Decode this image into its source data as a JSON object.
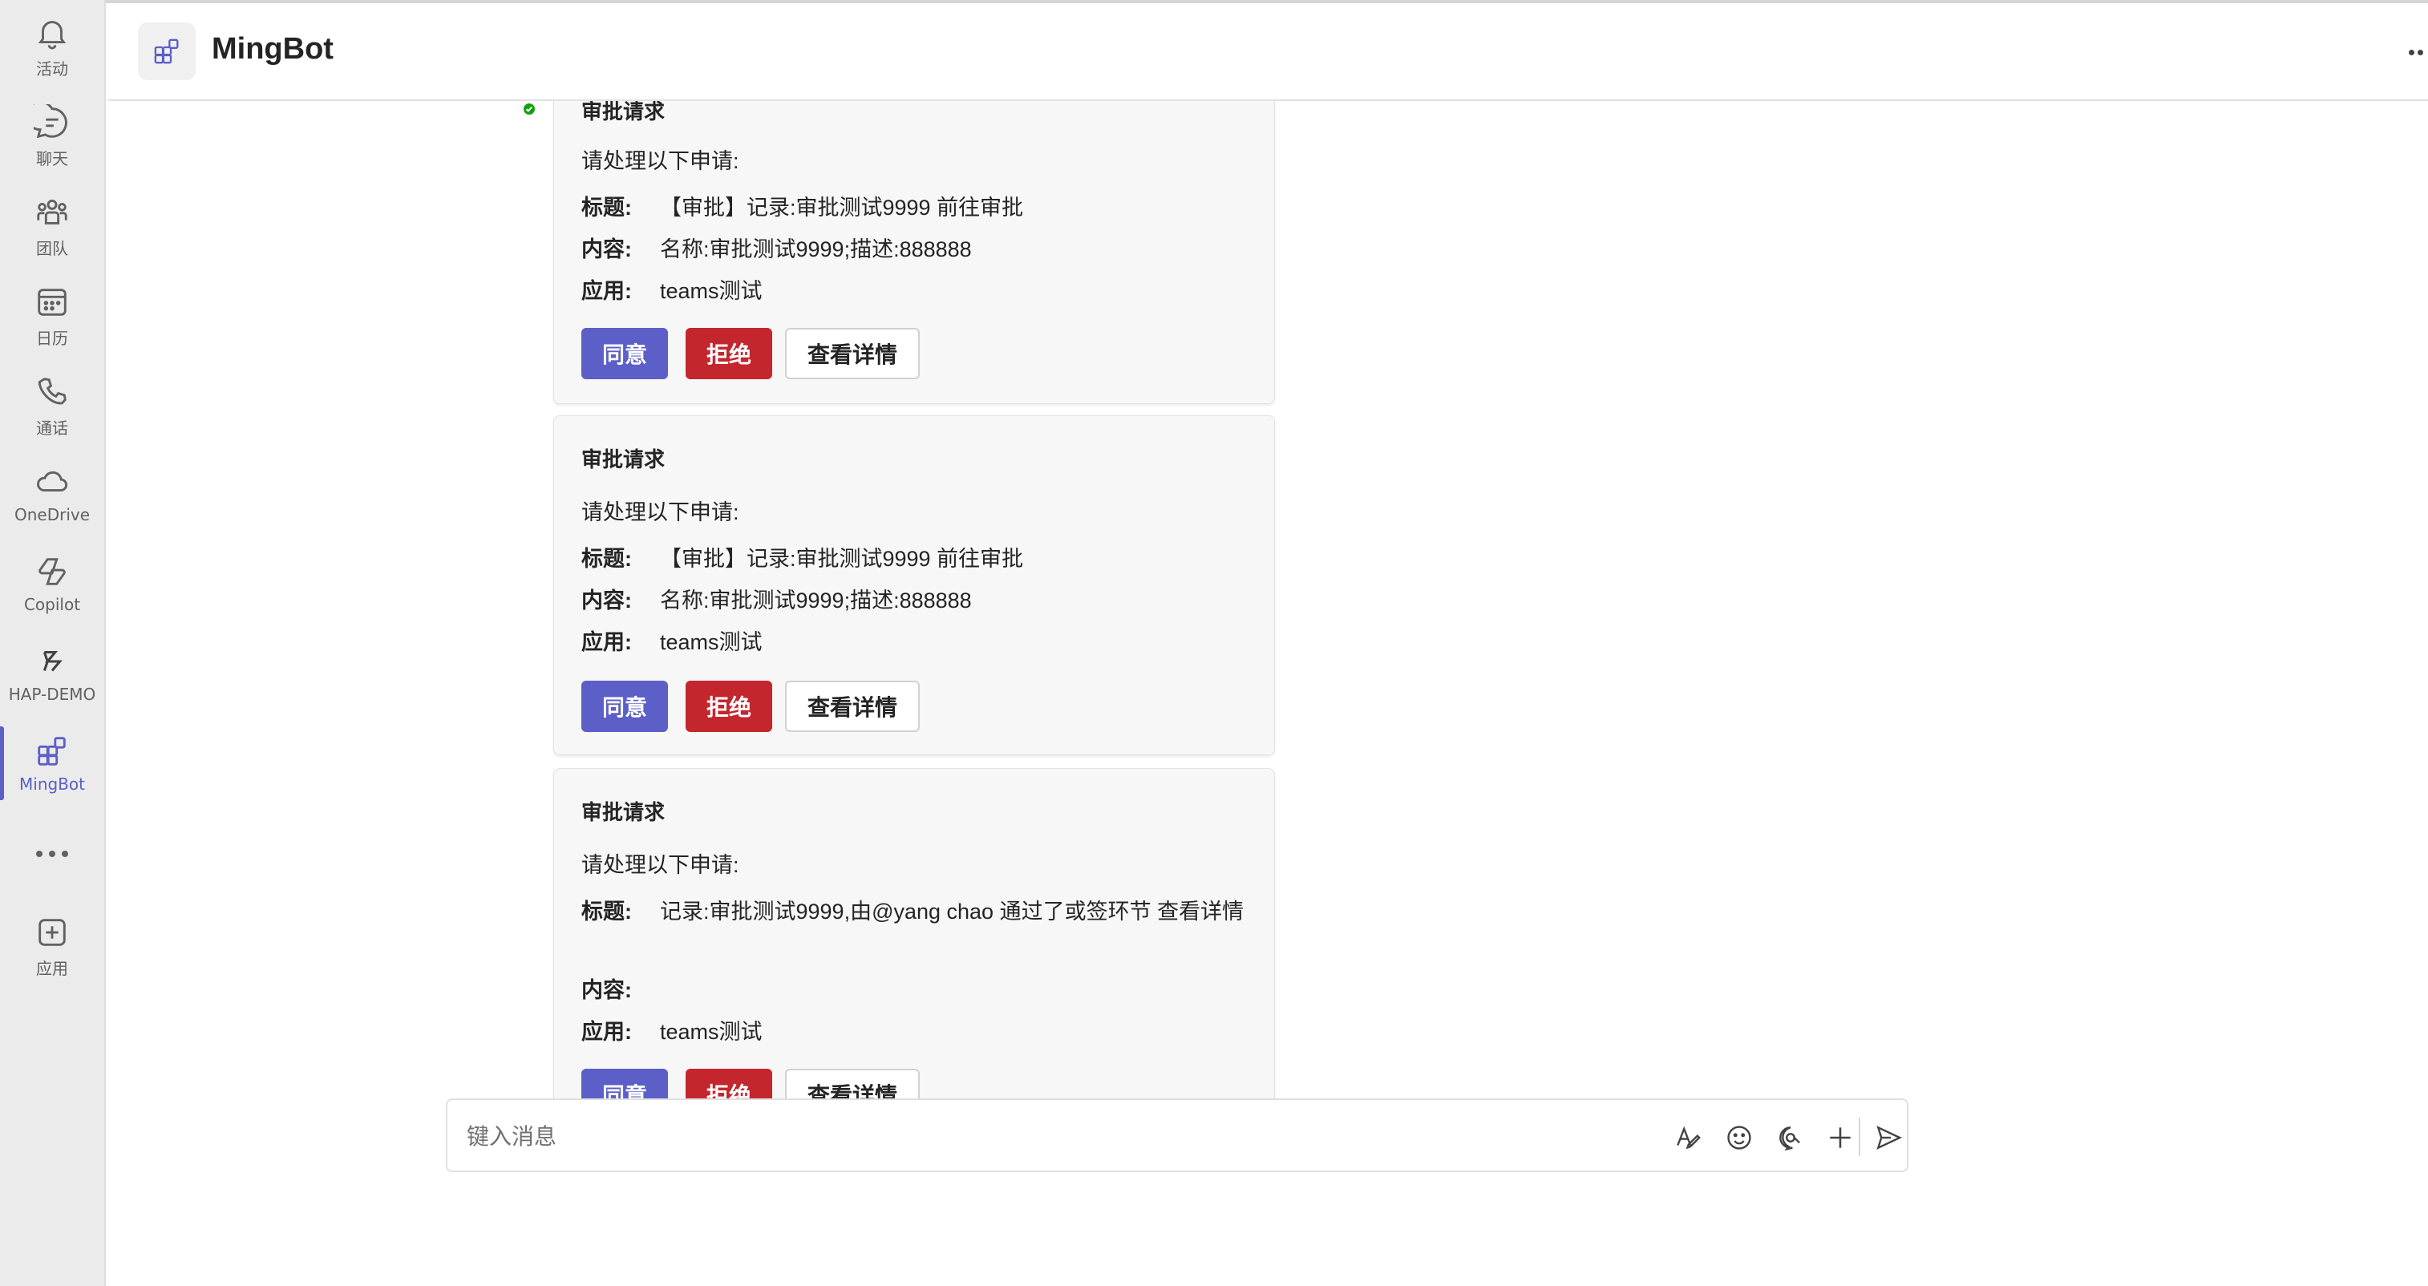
{
  "app": {
    "title": "MingBot"
  },
  "rail": {
    "items": [
      {
        "label": "活动",
        "icon": "bell-icon"
      },
      {
        "label": "聊天",
        "icon": "chat-icon"
      },
      {
        "label": "团队",
        "icon": "teams-icon"
      },
      {
        "label": "日历",
        "icon": "calendar-icon"
      },
      {
        "label": "通话",
        "icon": "phone-icon"
      },
      {
        "label": "OneDrive",
        "icon": "cloud-icon"
      },
      {
        "label": "Copilot",
        "icon": "copilot-icon"
      },
      {
        "label": "HAP-DEMO",
        "icon": "hap-icon"
      },
      {
        "label": "MingBot",
        "icon": "apps-grid-icon",
        "active": true
      },
      {
        "label": "应用",
        "icon": "add-app-icon"
      }
    ]
  },
  "cards": [
    {
      "title": "审批请求",
      "intro": "请处理以下申请:",
      "fields": [
        {
          "key": "标题:",
          "value": "【审批】记录:审批测试9999 前往审批"
        },
        {
          "key": "内容:",
          "value": "名称:审批测试9999;描述:888888"
        },
        {
          "key": "应用:",
          "value": "teams测试"
        }
      ],
      "buttons": {
        "approve": "同意",
        "reject": "拒绝",
        "detail": "查看详情"
      }
    },
    {
      "title": "审批请求",
      "intro": "请处理以下申请:",
      "fields": [
        {
          "key": "标题:",
          "value": "【审批】记录:审批测试9999 前往审批"
        },
        {
          "key": "内容:",
          "value": "名称:审批测试9999;描述:888888"
        },
        {
          "key": "应用:",
          "value": "teams测试"
        }
      ],
      "buttons": {
        "approve": "同意",
        "reject": "拒绝",
        "detail": "查看详情"
      }
    },
    {
      "title": "审批请求",
      "intro": "请处理以下申请:",
      "fields": [
        {
          "key": "标题:",
          "value": "记录:审批测试9999,由@yang chao 通过了或签环节 查看详情"
        },
        {
          "key": "内容:",
          "value": ""
        },
        {
          "key": "应用:",
          "value": "teams测试"
        }
      ],
      "buttons": {
        "approve": "同意",
        "reject": "拒绝",
        "detail": "查看详情"
      }
    }
  ],
  "composer": {
    "placeholder": "键入消息",
    "icons": [
      "format-icon",
      "emoji-icon",
      "sticker-icon",
      "attach-plus-icon",
      "send-icon"
    ]
  },
  "colors": {
    "accent": "#5b5fc7",
    "reject": "#c4262e",
    "rail_bg": "#ebebeb",
    "card_bg": "#f7f7f7"
  }
}
